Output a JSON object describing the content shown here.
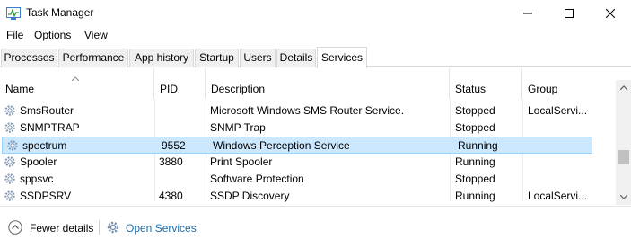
{
  "window": {
    "title": "Task Manager"
  },
  "menu": {
    "items": [
      "File",
      "Options",
      "View"
    ]
  },
  "tabs": [
    "Processes",
    "Performance",
    "App history",
    "Startup",
    "Users",
    "Details",
    "Services"
  ],
  "active_tab": "Services",
  "columns": {
    "name": "Name",
    "pid": "PID",
    "description": "Description",
    "status": "Status",
    "group": "Group"
  },
  "rows": [
    {
      "name": "SmsRouter",
      "pid": "",
      "description": "Microsoft Windows SMS Router Service.",
      "status": "Stopped",
      "group": "LocalServi..."
    },
    {
      "name": "SNMPTRAP",
      "pid": "",
      "description": "SNMP Trap",
      "status": "Stopped",
      "group": ""
    },
    {
      "name": "spectrum",
      "pid": "9552",
      "description": "Windows Perception Service",
      "status": "Running",
      "group": ""
    },
    {
      "name": "Spooler",
      "pid": "3880",
      "description": "Print Spooler",
      "status": "Running",
      "group": ""
    },
    {
      "name": "sppsvc",
      "pid": "",
      "description": "Software Protection",
      "status": "Stopped",
      "group": ""
    },
    {
      "name": "SSDPSRV",
      "pid": "4380",
      "description": "SSDP Discovery",
      "status": "Running",
      "group": "LocalServi..."
    }
  ],
  "footer": {
    "fewer_details": "Fewer details",
    "open_services": "Open Services"
  },
  "colors": {
    "selection": "#cce8ff",
    "selection_border": "#99d1ff",
    "link": "#1a6fb0"
  }
}
